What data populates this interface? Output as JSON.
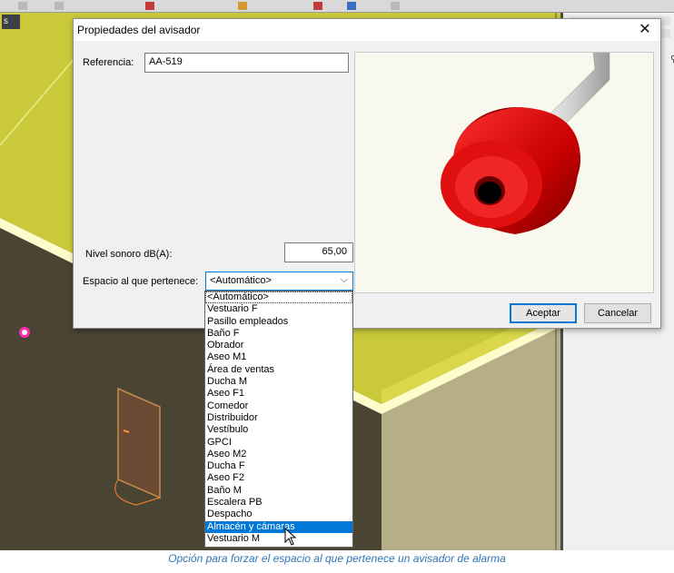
{
  "tab": {
    "label": "s"
  },
  "dialog": {
    "title": "Propiedades del avisador",
    "close_glyph": "✕",
    "referencia": {
      "label": "Referencia:",
      "value": "AA-519"
    },
    "nivel_sonoro": {
      "label": "Nivel sonoro dB(A):",
      "value": "65,00"
    },
    "espacio": {
      "label": "Espacio al que pertenece:",
      "selected": "<Automático>",
      "chevron_glyph": "⌵",
      "options": [
        "<Automático>",
        "Vestuario F",
        "Pasillo empleados",
        "Baño F",
        "Obrador",
        "Aseo M1",
        "Área de ventas",
        "Ducha M",
        "Aseo F1",
        "Comedor",
        "Distribuidor",
        "Vestíbulo",
        "GPCI",
        "Aseo M2",
        "Ducha F",
        "Aseo F2",
        "Baño M",
        "Escalera PB",
        "Despacho",
        "Almacén y cámaras",
        "Vestuario M"
      ],
      "highlighted": "Almacén y cámaras"
    },
    "buttons": {
      "accept": "Aceptar",
      "cancel": "Cancelar"
    }
  },
  "caption": "Opción para forzar el espacio al que pertenece un avisador de alarma",
  "icons": {
    "pin": "pin-icon",
    "close": "close-icon",
    "chevron": "chevron-down-icon",
    "cursor": "mouse-cursor-icon"
  },
  "colors": {
    "floor": "#c9c93a",
    "wall_dark": "#4a4433",
    "wall_light": "#b6ae88",
    "selection": "#0078d7",
    "caption": "#2e75b6",
    "alarm_red": "#d40000"
  }
}
